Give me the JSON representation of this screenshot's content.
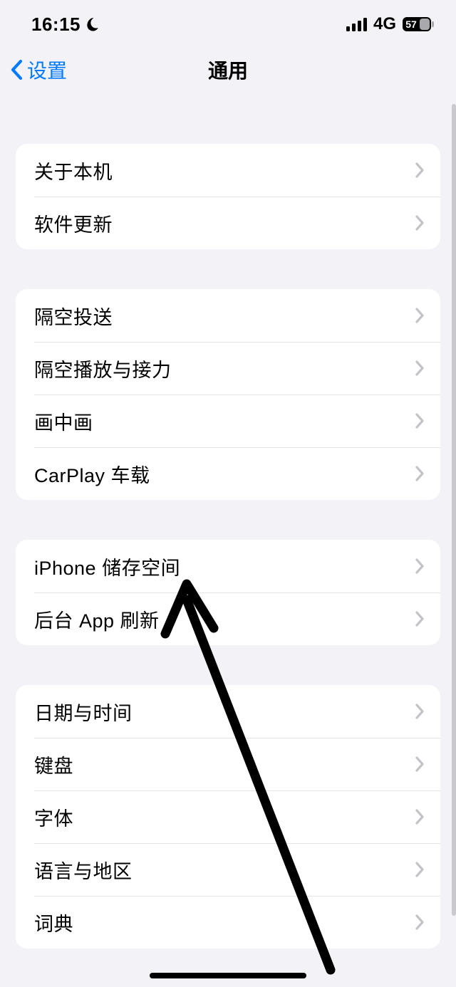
{
  "status": {
    "time": "16:15",
    "network": "4G",
    "battery_text": "57"
  },
  "nav": {
    "back_label": "设置",
    "title": "通用"
  },
  "groups": [
    {
      "items": [
        {
          "label": "关于本机",
          "name": "row-about"
        },
        {
          "label": "软件更新",
          "name": "row-software-update"
        }
      ]
    },
    {
      "items": [
        {
          "label": "隔空投送",
          "name": "row-airdrop"
        },
        {
          "label": "隔空播放与接力",
          "name": "row-airplay-handoff"
        },
        {
          "label": "画中画",
          "name": "row-picture-in-picture"
        },
        {
          "label": "CarPlay 车载",
          "name": "row-carplay"
        }
      ]
    },
    {
      "items": [
        {
          "label": "iPhone 储存空间",
          "name": "row-iphone-storage"
        },
        {
          "label": "后台 App 刷新",
          "name": "row-background-app-refresh"
        }
      ]
    },
    {
      "items": [
        {
          "label": "日期与时间",
          "name": "row-date-time"
        },
        {
          "label": "键盘",
          "name": "row-keyboard"
        },
        {
          "label": "字体",
          "name": "row-fonts"
        },
        {
          "label": "语言与地区",
          "name": "row-language-region"
        },
        {
          "label": "词典",
          "name": "row-dictionary"
        }
      ]
    }
  ]
}
